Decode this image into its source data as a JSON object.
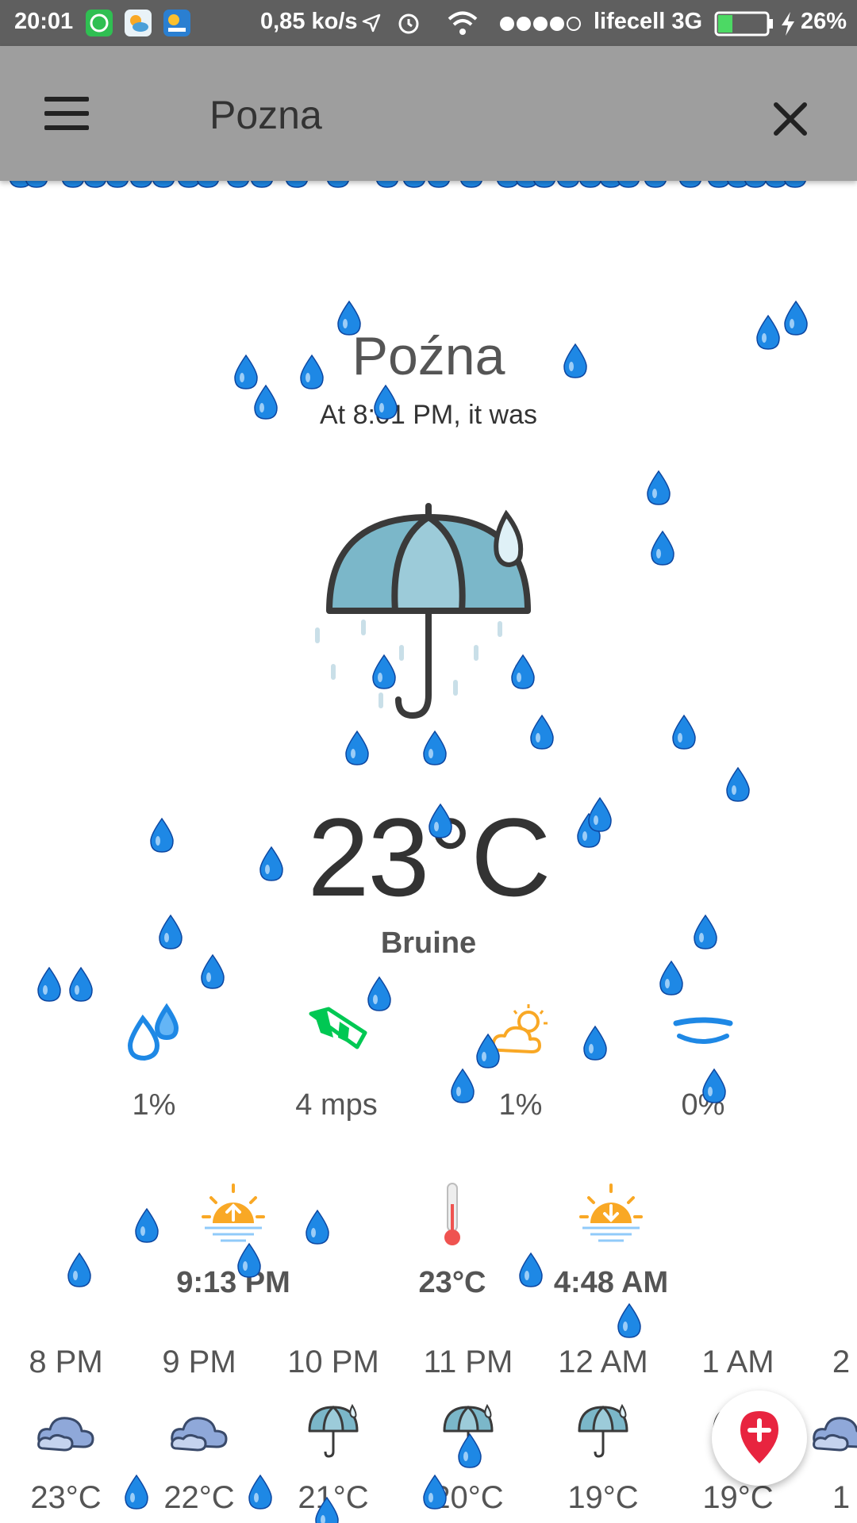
{
  "status_bar": {
    "time": "20:01",
    "speed": "0,85 ko/s",
    "carrier": "lifecell 3G",
    "battery": "26%",
    "icons": [
      "whatsapp-icon",
      "weather-app-icon",
      "forecast-app-icon",
      "location-arrow-icon",
      "alarm-icon",
      "wifi-icon",
      "signal-dots-icon",
      "battery-icon",
      "charging-icon"
    ]
  },
  "app_bar": {
    "menu_icon": "hamburger-menu-icon",
    "search_value": "Pozna",
    "close_icon": "close-icon"
  },
  "current": {
    "city": "Poźna",
    "time_caption": "At 8:01 PM, it was",
    "icon": "umbrella-rain-icon",
    "temperature": "23°C",
    "description": "Bruine"
  },
  "stats": [
    {
      "icon": "humidity-drops-icon",
      "value": "1%"
    },
    {
      "icon": "wind-windsock-icon",
      "value": "4 mps"
    },
    {
      "icon": "cloud-sun-icon",
      "value": "1%"
    },
    {
      "icon": "wave-icon",
      "value": "0%"
    }
  ],
  "sun": {
    "sunrise_icon": "sunrise-icon",
    "sunrise_value": "9:13 PM",
    "thermometer_icon": "thermometer-icon",
    "temp_value": "23°C",
    "sunset_icon": "sunset-icon",
    "sunset_value": "4:48 AM"
  },
  "hourly": [
    {
      "time": "8 PM",
      "icon": "cloud-icon",
      "temp": "23°C"
    },
    {
      "time": "9 PM",
      "icon": "cloud-icon",
      "temp": "22°C"
    },
    {
      "time": "10 PM",
      "icon": "umbrella-icon",
      "temp": "21°C"
    },
    {
      "time": "11 PM",
      "icon": "umbrella-icon",
      "temp": "20°C"
    },
    {
      "time": "12 AM",
      "icon": "umbrella-icon",
      "temp": "19°C"
    },
    {
      "time": "1 AM",
      "icon": "umbrella-icon",
      "temp": "19°C"
    },
    {
      "time": "2",
      "icon": "cloud-icon",
      "temp": "1"
    }
  ],
  "fab": {
    "icon": "add-location-icon"
  },
  "colors": {
    "status_bar": "#5f5f5f",
    "app_bar": "#9e9e9e",
    "rain_drop": "#1e88e5",
    "umbrella": "#7bb7c9",
    "accent_red": "#e8243f",
    "sun": "#f9a825"
  }
}
